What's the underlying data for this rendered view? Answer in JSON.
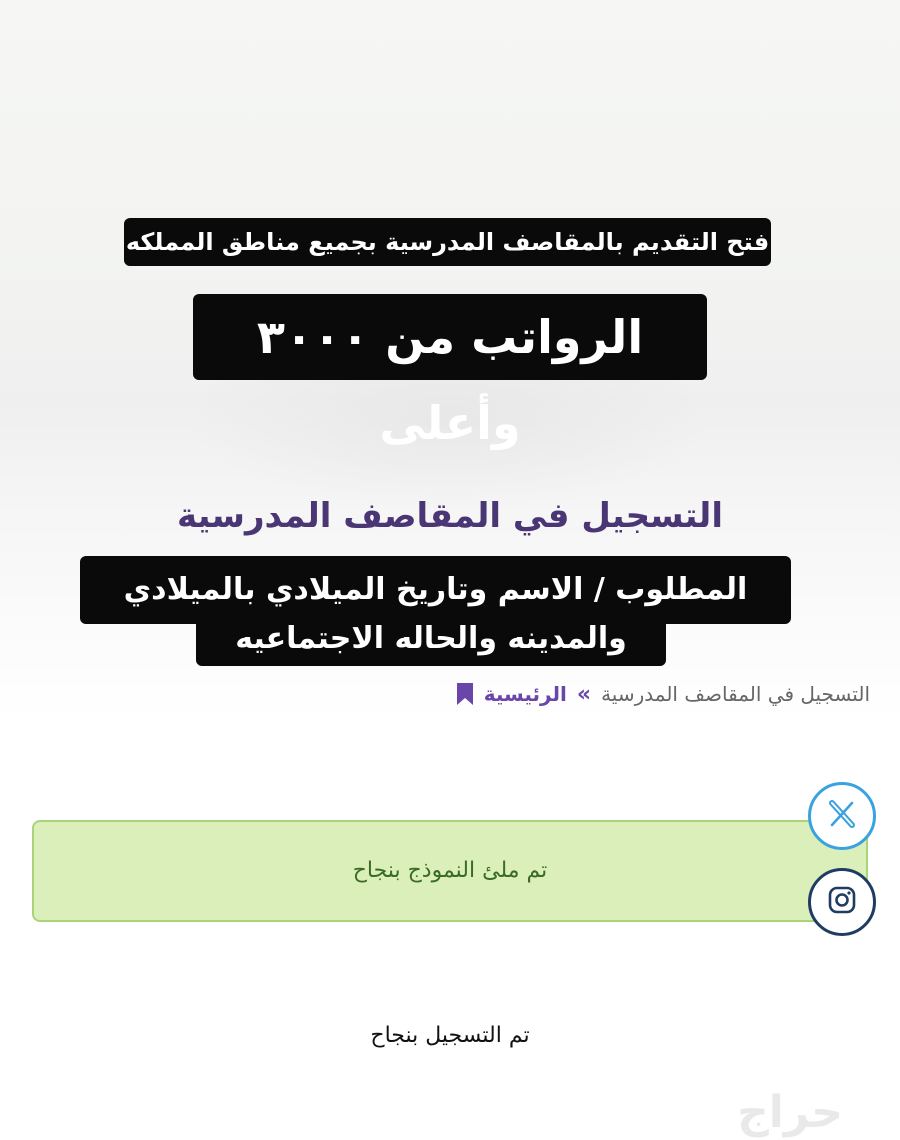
{
  "banners": {
    "application_open": "فتح التقديم بالمقاصف المدرسية بجميع مناطق المملكه",
    "salary": "الرواتب من ٣٠٠٠ وأعلى"
  },
  "page_title": "التسجيل في المقاصف المدرسية",
  "requirements": {
    "line1": "المطلوب / الاسم وتاريخ الميلادي بالميلادي",
    "line2": "والمدينه والحاله الاجتماعيه"
  },
  "breadcrumb": {
    "home": "الرئيسية",
    "separator": "»",
    "current": "التسجيل في المقاصف المدرسية"
  },
  "success_message": "تم ملئ النموذج بنجاح",
  "social": {
    "x_icon": "x-logo-icon",
    "instagram_icon": "instagram-icon"
  },
  "final_message": "تم التسجيل بنجاح",
  "watermark": "حراج",
  "colors": {
    "title_purple": "#4a3674",
    "breadcrumb_purple": "#6a46a8",
    "success_bg": "#dbefba",
    "success_border": "#a9d47a",
    "success_text": "#3b6b26",
    "x_blue": "#3ba2e0",
    "instagram_navy": "#1f3d63"
  }
}
